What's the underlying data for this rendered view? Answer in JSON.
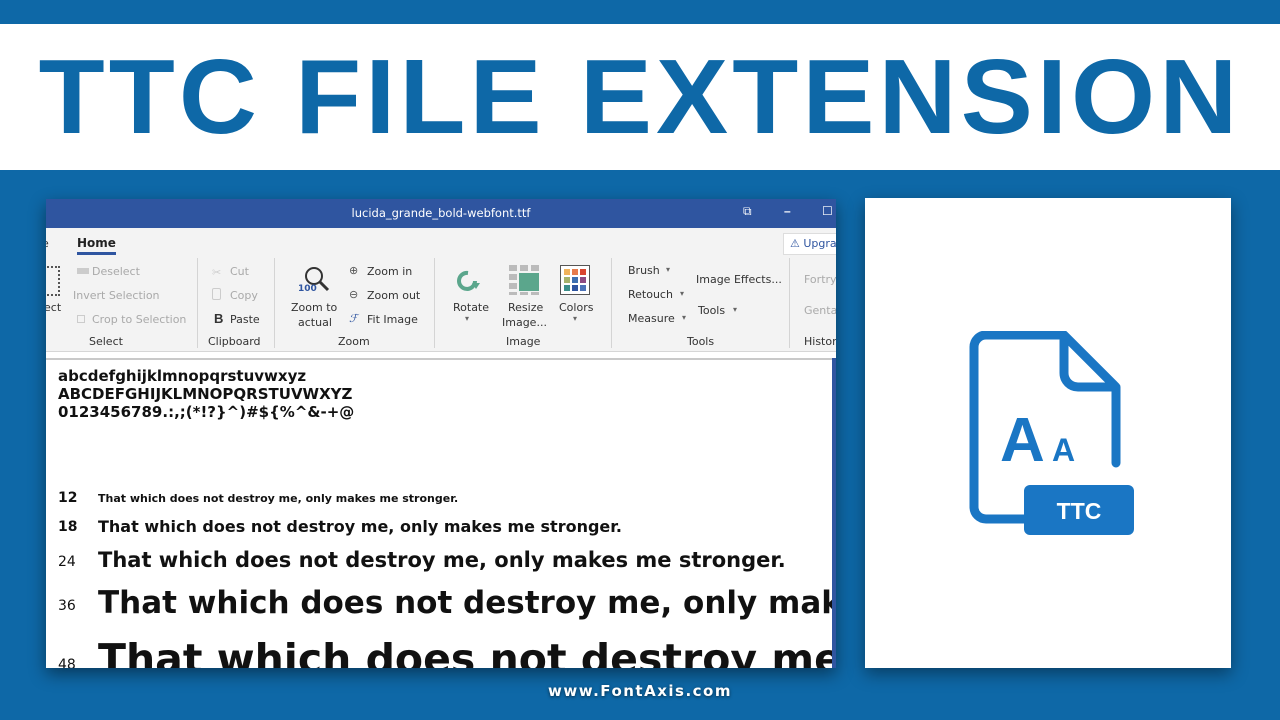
{
  "banner": {
    "title": "TTC FILE EXTENSION"
  },
  "window": {
    "title": "lucida_grande_bold-webfont.ttf",
    "buttons": {
      "restore": "⧉",
      "minimize": "–",
      "maximize": "☐"
    },
    "tabs": {
      "prev": "e",
      "home": "Home"
    },
    "upgrade_label": "Upgrade",
    "ribbon": {
      "select": {
        "partial_label": "ect",
        "deselect": "Deselect",
        "invert_selection": "Invert Selection",
        "crop_to_selection": "Crop to Selection",
        "group_label": "Select"
      },
      "clipboard": {
        "cut": "Cut",
        "copy": "Copy",
        "paste": "Paste",
        "group_label": "Clipboard"
      },
      "zoom": {
        "zoom_badge": "100",
        "zoom_to_actual_1": "Zoom to",
        "zoom_to_actual_2": "actual",
        "zoom_in": "Zoom in",
        "zoom_out": "Zoom out",
        "fit_image": "Fit Image",
        "group_label": "Zoom"
      },
      "image": {
        "rotate": "Rotate",
        "resize_1": "Resize",
        "resize_2": "Image...",
        "colors": "Colors",
        "group_label": "Image"
      },
      "tools": {
        "brush": "Brush",
        "retouch": "Retouch",
        "measure": "Measure",
        "image_effects": "Image Effects...",
        "tools": "Tools",
        "group_label": "Tools"
      },
      "history": {
        "item1": "Fortry",
        "item2": "Genta",
        "group_label": "Histor"
      }
    },
    "preview": {
      "lowercase": "abcdefghijklmnopqrstuvwxyz",
      "uppercase": "ABCDEFGHIJKLMNOPQRSTUVWXYZ",
      "symbols": "0123456789.:,;(*!?}^)#${%^&-+@",
      "sample_rows": [
        {
          "size": "12",
          "text": "That which does not destroy me, only makes me stronger."
        },
        {
          "size": "18",
          "text": "That which does not destroy me, only makes me stronger."
        },
        {
          "size": "24",
          "text": "That which does not destroy me, only makes me stronger."
        },
        {
          "size": "36",
          "text": "That which does not destroy me, only makes me stronger."
        },
        {
          "size": "48",
          "text": "That which does not destroy me, only makes me stronger."
        }
      ]
    }
  },
  "file_icon": {
    "badge": "TTC",
    "glyph_large": "A",
    "glyph_small": "A"
  },
  "footer": {
    "site": "www.FontAxis.com"
  },
  "colors": {
    "brand_blue": "#0e68a7",
    "titlebar_blue": "#2f55a0",
    "ribbon_bg": "#f3f3f3"
  }
}
